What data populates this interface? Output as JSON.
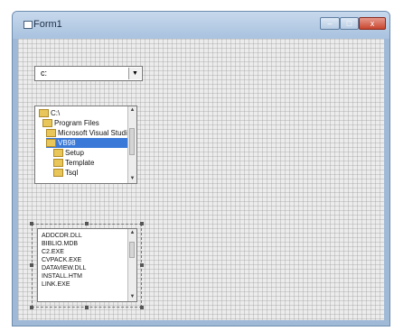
{
  "window": {
    "title": "Form1"
  },
  "title_controls": {
    "minimize": "–",
    "maximize": "□",
    "close": "x"
  },
  "drive_box": {
    "value": "c:",
    "arrow_icon": "chevron-down-icon"
  },
  "dir_list": {
    "items": [
      {
        "label": "C:\\",
        "selected": false
      },
      {
        "label": "Program Files",
        "selected": false
      },
      {
        "label": "Microsoft Visual Studio",
        "selected": false
      },
      {
        "label": "VB98",
        "selected": true
      },
      {
        "label": "Setup",
        "selected": false
      },
      {
        "label": "Template",
        "selected": false
      },
      {
        "label": "Tsql",
        "selected": false
      }
    ]
  },
  "file_list": {
    "items": [
      "ADDCDR.DLL",
      "BIBLIO.MDB",
      "C2.EXE",
      "CVPACK.EXE",
      "DATAVIEW.DLL",
      "INSTALL.HTM",
      "LINK.EXE"
    ]
  },
  "colors": {
    "selection": "#3a79d8",
    "titlebar": "#a9c2df",
    "close_button": "#c8452f"
  }
}
